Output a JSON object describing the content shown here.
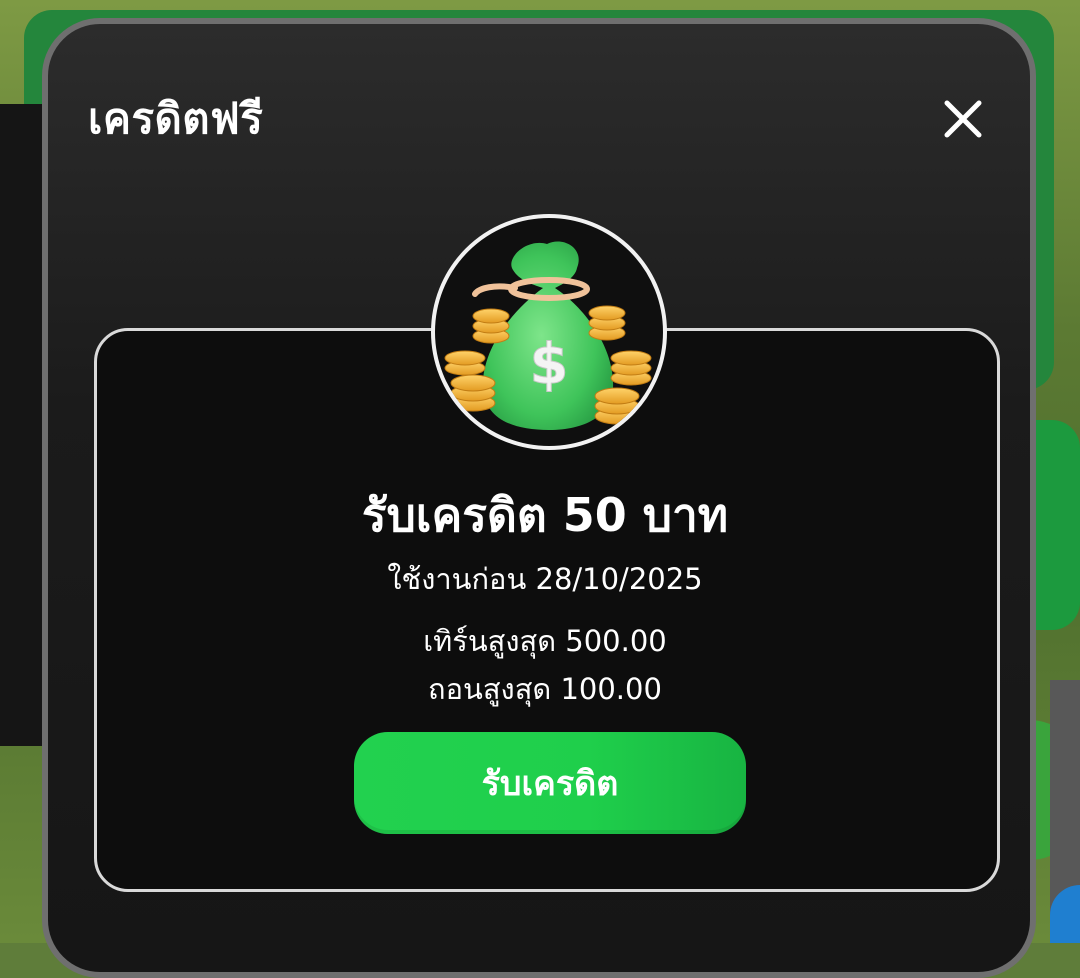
{
  "modal": {
    "title": "เครดิตฟรี",
    "close_icon": "close-icon",
    "bonus_icon": "money-bag-icon"
  },
  "offer": {
    "title": "รับเครดิต 50 บาท",
    "expiry": "ใช้งานก่อน 28/10/2025",
    "turnover": "เทิร์นสูงสุด 500.00",
    "max_withdraw": "ถอนสูงสุด 100.00",
    "claim_label": "รับเครดิต"
  },
  "colors": {
    "accent": "#22d14f",
    "modal_bg": "#1b1b1b",
    "text": "#ffffff"
  }
}
